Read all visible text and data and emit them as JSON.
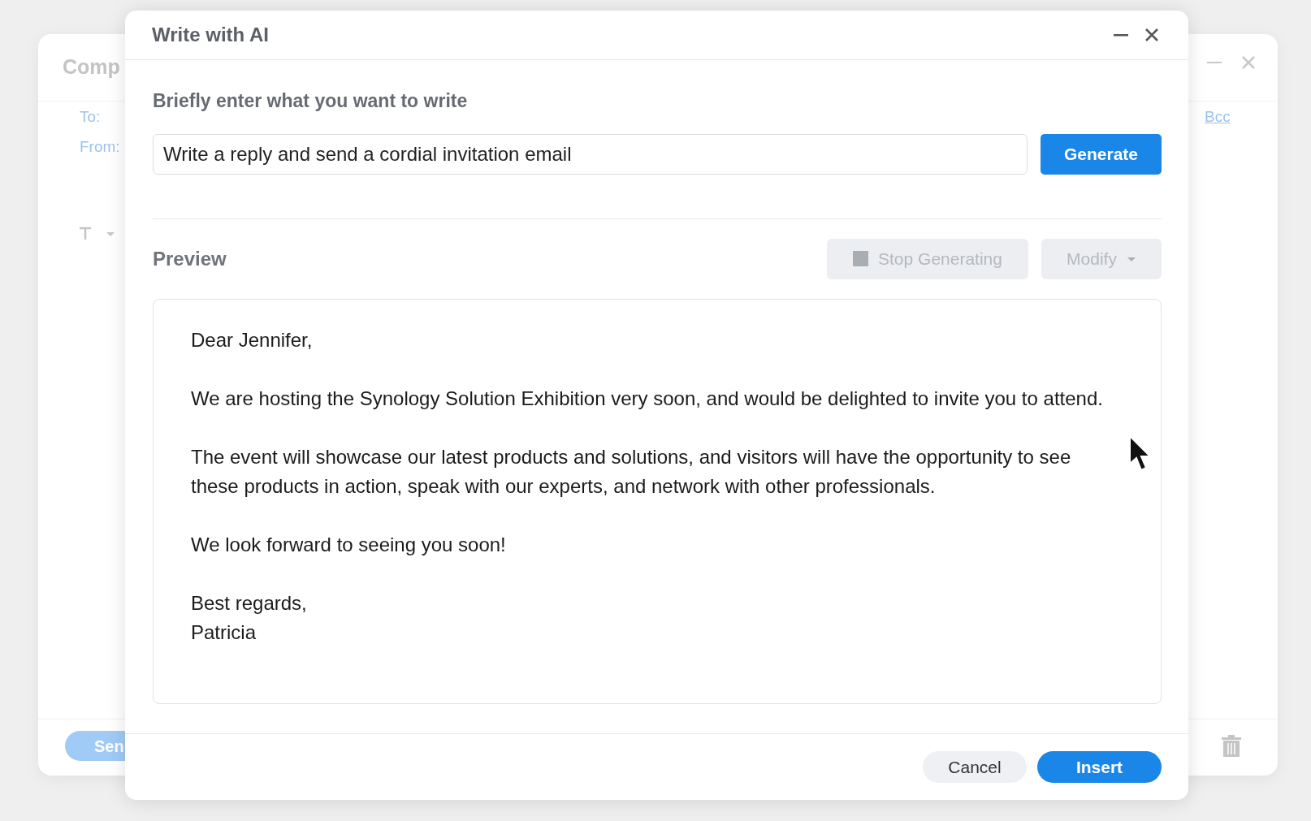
{
  "background_window": {
    "title": "Comp",
    "to_label": "To:",
    "from_label": "From:",
    "bcc_link": "Bcc",
    "send_button": "Sen"
  },
  "dialog": {
    "title": "Write with AI",
    "prompt_label": "Briefly enter what you want to write",
    "prompt": {
      "value": "Write a reply and send a cordial invitation email"
    },
    "generate_button": "Generate",
    "preview_label": "Preview",
    "stop_button": {
      "label": "Stop Generating",
      "disabled": true
    },
    "modify_button": {
      "label": "Modify",
      "disabled": true
    },
    "preview_paragraphs": [
      {
        "lines": [
          "Dear Jennifer,"
        ]
      },
      {
        "lines": [
          "We are hosting the Synology Solution Exhibition very soon, and would be delighted to invite you to attend."
        ]
      },
      {
        "lines": [
          "The event will showcase our latest products and solutions, and visitors will have the opportunity to see these products in action, speak with our experts, and network with other professionals."
        ]
      },
      {
        "lines": [
          "We look forward to seeing you soon!"
        ]
      },
      {
        "lines": [
          "Best regards,",
          "Patricia"
        ]
      }
    ],
    "cancel_button": "Cancel",
    "insert_button": "Insert"
  }
}
